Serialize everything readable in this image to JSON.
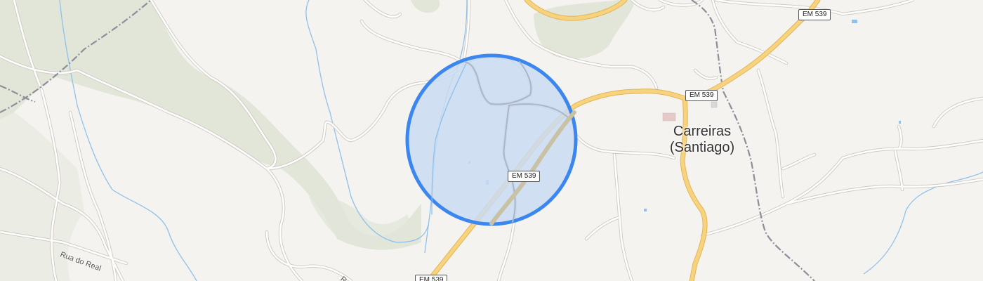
{
  "map": {
    "place": {
      "line1": "Carreiras",
      "line2": "(Santiago)"
    },
    "road_shields": [
      {
        "id": "top",
        "text": "EM 539"
      },
      {
        "id": "mid",
        "text": "EM 539"
      },
      {
        "id": "center",
        "text": "EM 539"
      },
      {
        "id": "bottom",
        "text": "EM 539"
      }
    ],
    "streets": [
      {
        "id": "rua-do-real",
        "text": "Rua do Real"
      },
      {
        "id": "partial",
        "text": "R"
      }
    ],
    "colors": {
      "background": "#f5f3f0",
      "forest": "#e2e6d9",
      "road_major": "#f6d37c",
      "road_minor": "#ffffff",
      "water": "#8fc1ea",
      "railway": "#8e8e9a",
      "selection_fill": "#c9daf2",
      "selection_stroke": "#3b86ef"
    }
  }
}
